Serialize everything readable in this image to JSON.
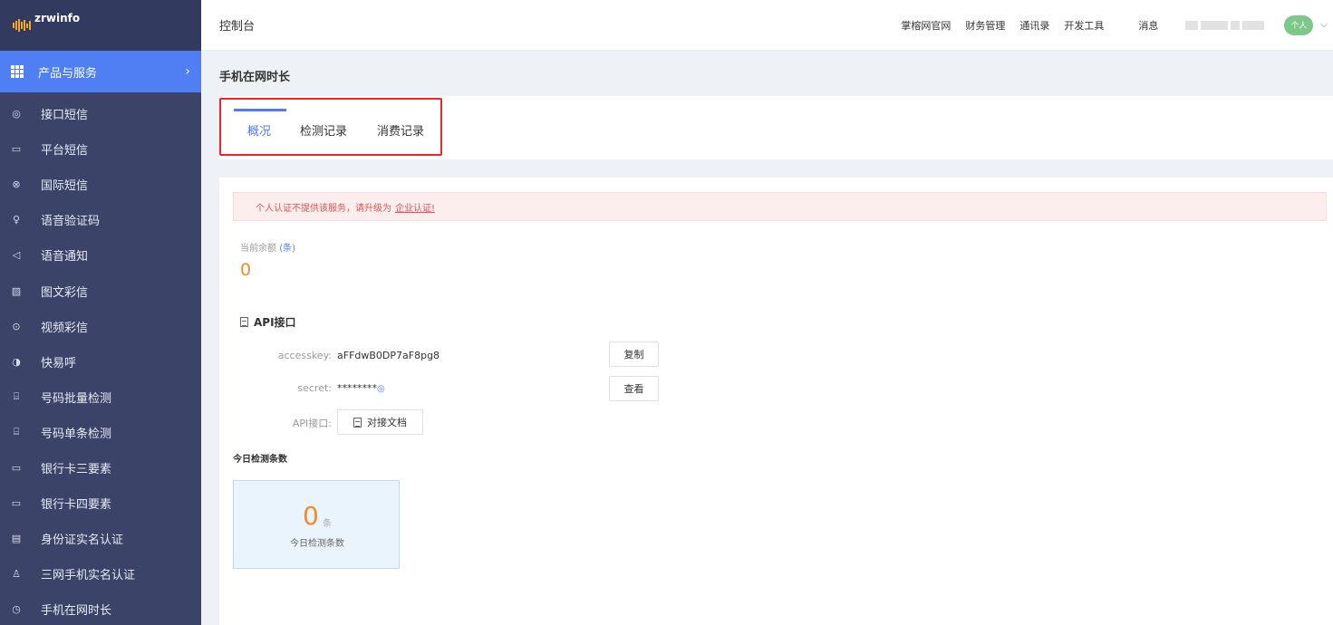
{
  "sidebar": {
    "logo_text": "zrwinfo",
    "active_group": "产品与服务",
    "items": [
      {
        "label": "接口短信",
        "icon": "chat-circle-icon"
      },
      {
        "label": "平台短信",
        "icon": "chat-bubble-icon"
      },
      {
        "label": "国际短信",
        "icon": "globe-icon"
      },
      {
        "label": "语音验证码",
        "icon": "microphone-icon"
      },
      {
        "label": "语音通知",
        "icon": "speaker-icon"
      },
      {
        "label": "图文彩信",
        "icon": "image-icon"
      },
      {
        "label": "视频彩信",
        "icon": "play-circle-icon"
      },
      {
        "label": "快易呼",
        "icon": "phone-circle-icon"
      },
      {
        "label": "号码批量检测",
        "icon": "scan-icon"
      },
      {
        "label": "号码单条检测",
        "icon": "scan-single-icon"
      },
      {
        "label": "银行卡三要素",
        "icon": "card-icon"
      },
      {
        "label": "银行卡四要素",
        "icon": "card-icon"
      },
      {
        "label": "身份证实名认证",
        "icon": "id-card-icon"
      },
      {
        "label": "三网手机实名认证",
        "icon": "user-check-icon"
      },
      {
        "label": "手机在网时长",
        "icon": "clock-icon"
      }
    ]
  },
  "header": {
    "title": "控制台",
    "links": [
      "掌榕网官网",
      "财务管理",
      "通讯录",
      "开发工具"
    ],
    "message": "消息",
    "avatar_text": "个人"
  },
  "page": {
    "heading": "手机在网时长",
    "tabs": [
      "概况",
      "检测记录",
      "消费记录"
    ]
  },
  "alert": {
    "text": "个人认证不提供该服务，请升级为",
    "link": "企业认证!"
  },
  "balance": {
    "label": "当前余额",
    "unit": "(条)",
    "value": "0"
  },
  "api": {
    "title": "API接口",
    "accesskey_label": "accesskey:",
    "accesskey_value": "aFFdwB0DP7aF8pg8",
    "secret_label": "secret:",
    "secret_value": "********",
    "api_label": "API接口:",
    "copy_button": "复制",
    "view_button": "查看",
    "doc_button": "对接文档"
  },
  "today": {
    "title": "今日检测条数",
    "count": "0",
    "unit": "条",
    "label": "今日检测条数"
  },
  "colors": {
    "sidebar_bg": "#3b4369",
    "active_blue": "#4f7ff2",
    "accent_orange": "#f58a2b",
    "highlight_red": "#e7272b"
  }
}
